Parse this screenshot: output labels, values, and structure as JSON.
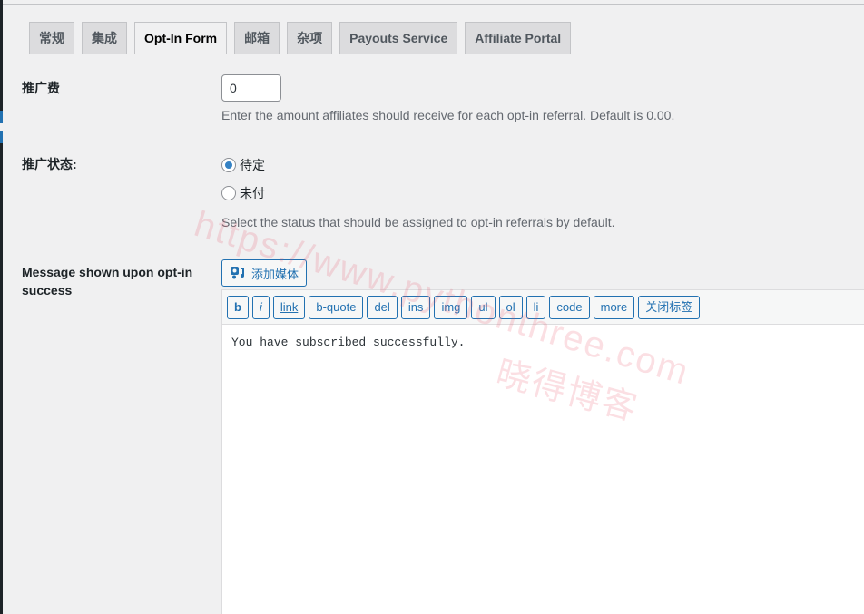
{
  "tabs": [
    {
      "label": "常规",
      "active": false
    },
    {
      "label": "集成",
      "active": false
    },
    {
      "label": "Opt-In Form",
      "active": true
    },
    {
      "label": "邮箱",
      "active": false
    },
    {
      "label": "杂项",
      "active": false
    },
    {
      "label": "Payouts Service",
      "active": false
    },
    {
      "label": "Affiliate Portal",
      "active": false
    }
  ],
  "referral_amount": {
    "label": "推广费",
    "value": "0",
    "description": "Enter the amount affiliates should receive for each opt-in referral. Default is 0.00."
  },
  "referral_status": {
    "label": "推广状态:",
    "options": [
      {
        "label": "待定",
        "checked": true
      },
      {
        "label": "未付",
        "checked": false
      }
    ],
    "description": "Select the status that should be assigned to opt-in referrals by default."
  },
  "success_message": {
    "label": "Message shown upon opt-in success",
    "add_media_label": "添加媒体",
    "toolbar": [
      "b",
      "i",
      "link",
      "b-quote",
      "del",
      "ins",
      "img",
      "ul",
      "ol",
      "li",
      "code",
      "more",
      "关闭标签"
    ],
    "content": "You have subscribed successfully."
  },
  "watermark": {
    "line1": "https://www.pythonthree.com",
    "line2": "晓得博客"
  },
  "colors": {
    "accent": "#2271b1",
    "radio_checked": "#3582c4",
    "background": "#f0f0f1"
  }
}
